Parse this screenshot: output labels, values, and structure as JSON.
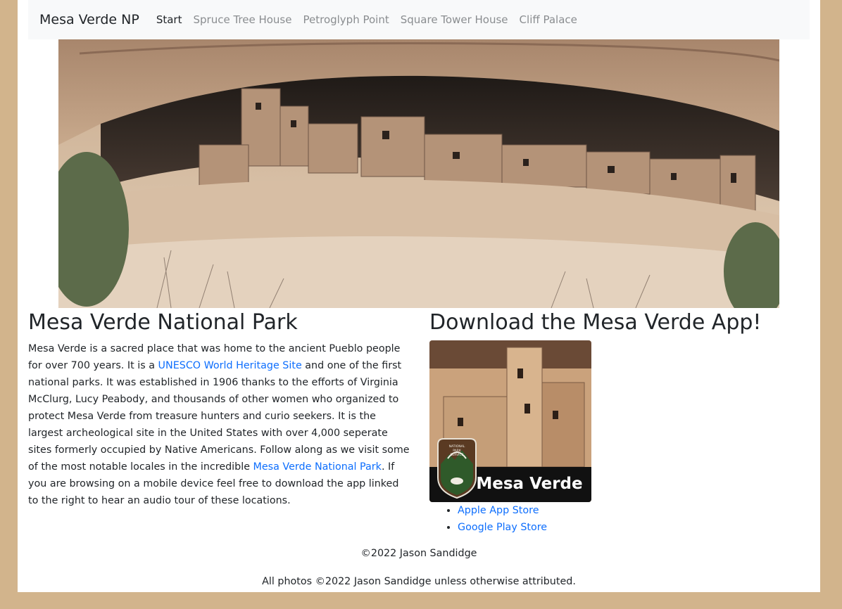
{
  "nav": {
    "brand": "Mesa Verde NP",
    "items": [
      "Start",
      "Spruce Tree House",
      "Petroglyph Point",
      "Square Tower House",
      "Cliff Palace"
    ],
    "active_index": 0
  },
  "main": {
    "heading": "Mesa Verde National Park",
    "paragraph": {
      "part1": "Mesa Verde is a sacred place that was home to the ancient Pueblo people for over 700 years. It is a ",
      "link1": "UNESCO World Heritage Site",
      "part2": " and one of the first national parks. It was established in 1906 thanks to the efforts of Virginia McClurg, Lucy Peabody, and thousands of other women who organized to protect Mesa Verde from treasure hunters and curio seekers. It is the largest archeological site in the United States with over 4,000 seperate sites formerly occupied by Native Americans. Follow along as we visit some of the most notable locales in the incredible ",
      "link2": "Mesa Verde National Park",
      "part3": ". If you are browsing on a mobile device feel free to download the app linked to the right to hear an audio tour of these locations."
    }
  },
  "app": {
    "heading": "Download the Mesa Verde App!",
    "logo_text": "Mesa Verde",
    "badge_text": [
      "NATIONAL",
      "PARK",
      "SERVICE"
    ],
    "stores": [
      "Apple App Store",
      "Google Play Store"
    ]
  },
  "footer": {
    "copyright": "©2022 Jason Sandidge",
    "photos": "All photos ©2022 Jason Sandidge unless otherwise attributed."
  },
  "colors": {
    "background": "#d2b48c",
    "navbar": "#f8f9fa",
    "link": "#0d6efd"
  }
}
